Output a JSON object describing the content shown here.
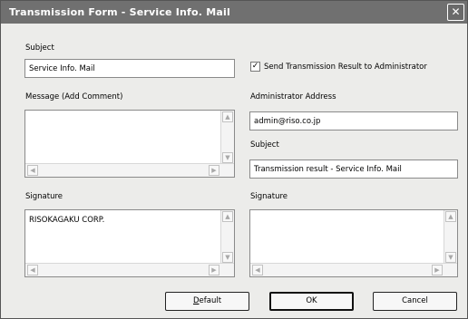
{
  "window": {
    "title": "Transmission Form - Service Info. Mail",
    "close_glyph": "✕"
  },
  "left": {
    "subject_label": "Subject",
    "subject_value": "Service Info. Mail",
    "message_label": "Message (Add Comment)",
    "message_value": "",
    "signature_label": "Signature",
    "signature_value": "RISOKAGAKU CORP."
  },
  "right": {
    "send_result_checked": true,
    "check_glyph": "✓",
    "send_result_label": "Send Transmission Result to Administrator",
    "admin_address_label": "Administrator Address",
    "admin_address_value": "admin@riso.co.jp",
    "subject_label": "Subject",
    "subject_value": "Transmission result - Service Info. Mail",
    "signature_label": "Signature",
    "signature_value": ""
  },
  "scroll_glyphs": {
    "up": "▲",
    "down": "▼",
    "left": "◀",
    "right": "▶"
  },
  "buttons": {
    "default_accel": "D",
    "default_rest": "efault",
    "ok": "OK",
    "cancel": "Cancel"
  }
}
